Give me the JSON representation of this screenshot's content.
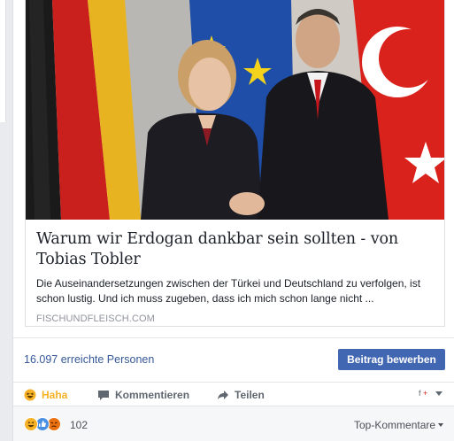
{
  "link": {
    "headline": "Warum wir Erdogan dankbar sein sollten - von Tobias Tobler",
    "description": "Die Auseinandersetzungen zwischen der Türkei und Deutschland zu verfolgen, ist schon lustig. Und ich muss zugeben, dass ich mich schon lange nicht ...",
    "domain": "FISCHUNDFLEISCH.COM"
  },
  "reach": {
    "text": "16.097 erreichte Personen",
    "boost_label": "Beitrag bewerben"
  },
  "actions": {
    "haha": "Haha",
    "comment": "Kommentieren",
    "share": "Teilen"
  },
  "reactions": {
    "count": "102",
    "icons": [
      "haha-icon",
      "like-icon",
      "angry-icon"
    ],
    "sort_label": "Top-Kommentare"
  },
  "colors": {
    "link_blue": "#365899",
    "button_blue": "#4267b2",
    "haha_yellow": "#f7b125"
  }
}
